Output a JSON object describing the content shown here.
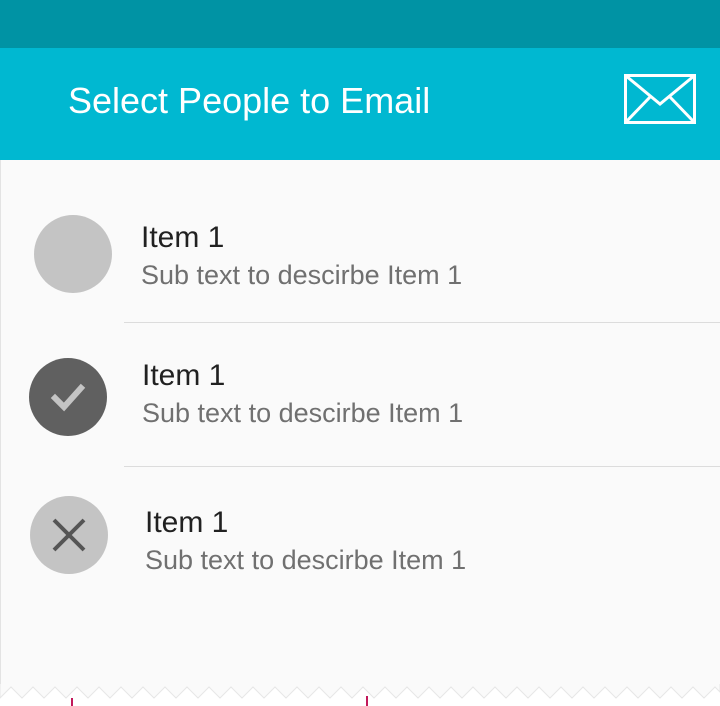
{
  "colors": {
    "status_bar": "#0093a4",
    "app_bar": "#00b8d1",
    "background": "#fafafa",
    "avatar_default": "#c4c4c4",
    "avatar_selected": "#606060",
    "divider": "#dcdcdc"
  },
  "app_bar": {
    "title": "Select People to Email",
    "action_icon": "envelope-icon"
  },
  "list": {
    "items": [
      {
        "title": "Item 1",
        "subtitle": "Sub text to descirbe Item 1",
        "avatar_state": "default",
        "avatar_icon": "none"
      },
      {
        "title": "Item 1",
        "subtitle": "Sub text to descirbe Item 1",
        "avatar_state": "selected",
        "avatar_icon": "checkmark-icon"
      },
      {
        "title": "Item 1",
        "subtitle": "Sub text to descirbe Item 1",
        "avatar_state": "removable",
        "avatar_icon": "close-icon"
      }
    ]
  }
}
